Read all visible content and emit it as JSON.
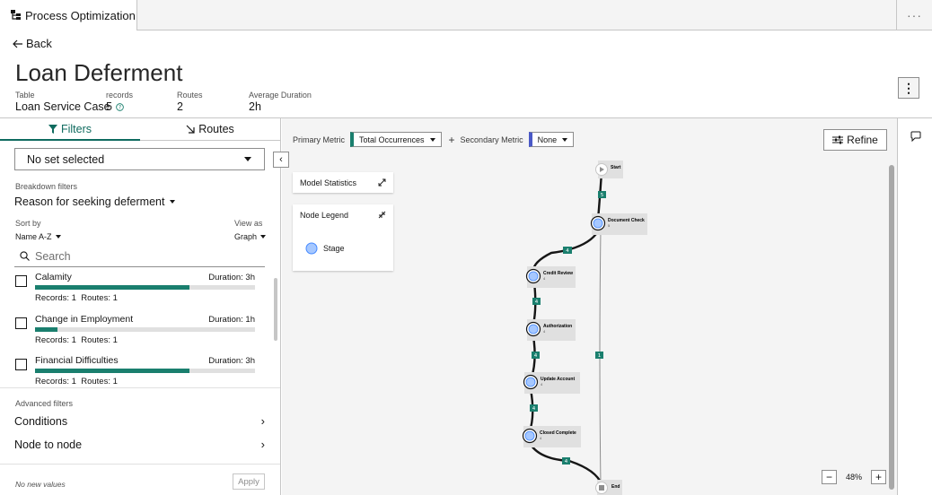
{
  "app": {
    "tab_title": "Process Optimization",
    "overflow": "···"
  },
  "nav": {
    "back_label": "Back"
  },
  "page": {
    "title": "Loan Deferment",
    "meta": [
      {
        "label": "Table",
        "value": "Loan Service Case"
      },
      {
        "label": "records",
        "value": "5"
      },
      {
        "label": "Routes",
        "value": "2"
      },
      {
        "label": "Average Duration",
        "value": "2h"
      }
    ]
  },
  "left_panel": {
    "tabs": {
      "filters": "Filters",
      "routes": "Routes"
    },
    "set_select": "No set selected",
    "breakdown": {
      "label": "Breakdown filters",
      "value": "Reason for seeking deferment"
    },
    "sort": {
      "label": "Sort by",
      "value": "Name A-Z"
    },
    "view": {
      "label": "View as",
      "value": "Graph"
    },
    "search_placeholder": "Search",
    "items": [
      {
        "name": "Calamity",
        "duration": "Duration: 3h",
        "fill": 0.7,
        "records": "Records: 1",
        "routes": "Routes: 1"
      },
      {
        "name": "Change in Employment",
        "duration": "Duration: 1h",
        "fill": 0.1,
        "records": "Records: 1",
        "routes": "Routes: 1"
      },
      {
        "name": "Financial Difficulties",
        "duration": "Duration: 3h",
        "fill": 0.7,
        "records": "Records: 1",
        "routes": "Routes: 1"
      }
    ],
    "advanced": {
      "label": "Advanced filters",
      "conditions": "Conditions",
      "node_to_node": "Node to node"
    },
    "footer": {
      "note": "No new values",
      "apply": "Apply"
    }
  },
  "canvas": {
    "primary_metric_label": "Primary Metric",
    "primary_metric_value": "Total Occurrences",
    "secondary_metric_label": "Secondary Metric",
    "secondary_metric_value": "None",
    "refine_label": "Refine",
    "model_statistics": "Model Statistics",
    "node_legend": "Node Legend",
    "legend_stage": "Stage",
    "zoom": "48%",
    "colors": {
      "accent": "#0f6b5f",
      "edge_badge": "#1a7f6e",
      "secondary_accent": "#4a59c7",
      "node_fill": "#a6c8ff"
    },
    "nodes": [
      {
        "label": "Start",
        "count": ""
      },
      {
        "label": "Document Check",
        "count": "5"
      },
      {
        "label": "Credit Review",
        "count": "4"
      },
      {
        "label": "Authorization",
        "count": "4"
      },
      {
        "label": "Update Account",
        "count": "4"
      },
      {
        "label": "Closed Complete",
        "count": "4"
      },
      {
        "label": "End",
        "count": ""
      }
    ],
    "edges": [
      "5",
      "4",
      "4",
      "4",
      "4",
      "4",
      "1"
    ]
  }
}
